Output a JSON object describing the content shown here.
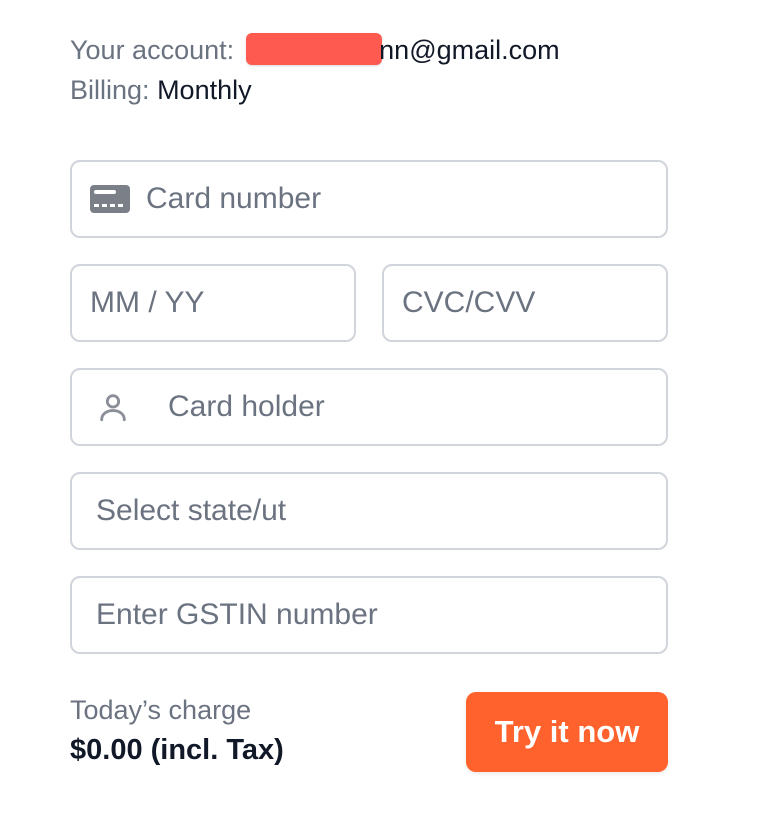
{
  "account": {
    "label": "Your account:",
    "email_visible_suffix": "nn@gmail.com"
  },
  "billing": {
    "label": "Billing:",
    "value": "Monthly"
  },
  "form": {
    "card_number_placeholder": "Card number",
    "expiry_placeholder": "MM / YY",
    "cvc_placeholder": "CVC/CVV",
    "card_holder_placeholder": "Card holder",
    "state_placeholder": "Select state/ut",
    "gstin_placeholder": "Enter GSTIN number"
  },
  "charge": {
    "label": "Today’s charge",
    "value": "$0.00 (incl. Tax)"
  },
  "cta": {
    "label": "Try it now",
    "color": "#ff622c"
  },
  "icons": {
    "card": "credit-card-icon",
    "user": "user-icon"
  },
  "colors": {
    "redaction": "#ff5a4f",
    "muted_text": "#6b7280",
    "border": "#d1d5db"
  }
}
